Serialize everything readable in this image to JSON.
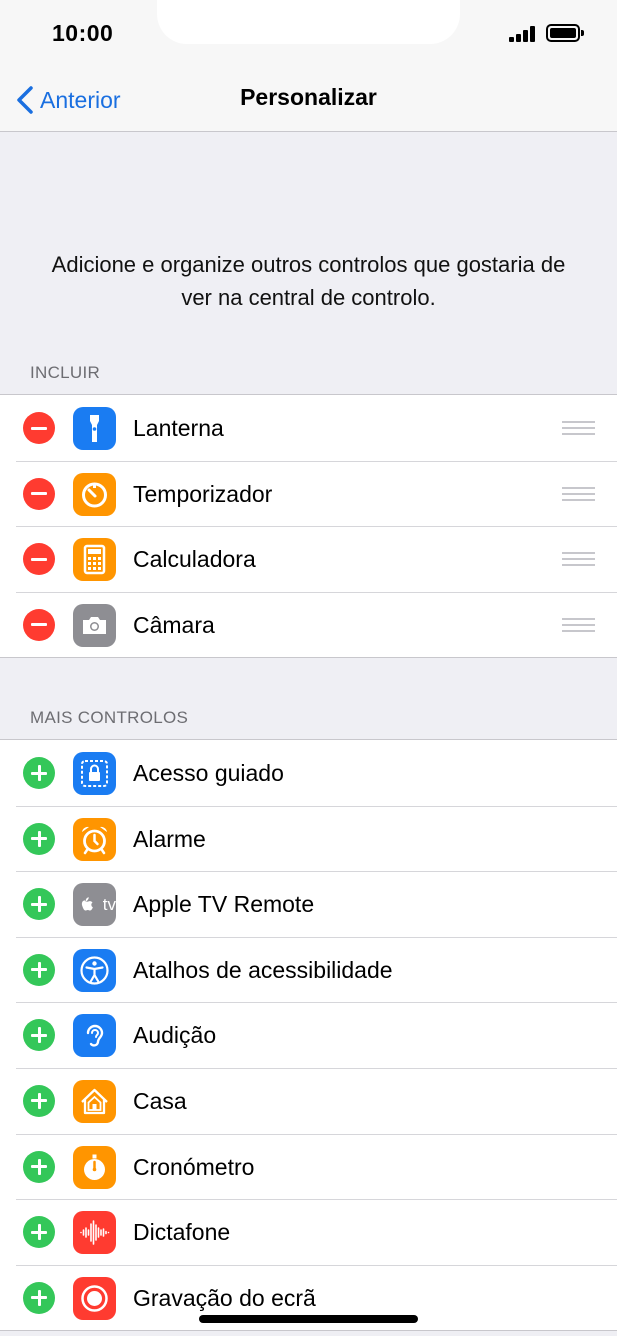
{
  "status_bar": {
    "time": "10:00"
  },
  "nav": {
    "back_label": "Anterior",
    "title": "Personalizar"
  },
  "intro": "Adicione e organize outros controlos que gostaria de ver na central de controlo.",
  "sections": {
    "included": {
      "header": "INCLUIR",
      "items": [
        {
          "label": "Lanterna",
          "icon": "flashlight-icon",
          "color": "#1a7cf2"
        },
        {
          "label": "Temporizador",
          "icon": "timer-icon",
          "color": "#ff9500"
        },
        {
          "label": "Calculadora",
          "icon": "calculator-icon",
          "color": "#ff9500"
        },
        {
          "label": "Câmara",
          "icon": "camera-icon",
          "color": "#8e8e93"
        }
      ]
    },
    "more": {
      "header": "MAIS CONTROLOS",
      "items": [
        {
          "label": "Acesso guiado",
          "icon": "guided-access-icon",
          "color": "#1a7cf2"
        },
        {
          "label": "Alarme",
          "icon": "alarm-icon",
          "color": "#ff9500"
        },
        {
          "label": "Apple TV Remote",
          "icon": "apple-tv-icon",
          "color": "#8e8e93",
          "icon_text": "tv"
        },
        {
          "label": "Atalhos de acessibilidade",
          "icon": "accessibility-icon",
          "color": "#1a7cf2"
        },
        {
          "label": "Audição",
          "icon": "hearing-icon",
          "color": "#1a7cf2"
        },
        {
          "label": "Casa",
          "icon": "home-icon",
          "color": "#ff9500"
        },
        {
          "label": "Cronómetro",
          "icon": "stopwatch-icon",
          "color": "#ff9500"
        },
        {
          "label": "Dictafone",
          "icon": "voice-memos-icon",
          "color": "#ff3b30"
        },
        {
          "label": "Gravação do ecrã",
          "icon": "screen-recording-icon",
          "color": "#ff3b30"
        }
      ]
    }
  },
  "colors": {
    "accent": "#1a6fe0",
    "remove": "#ff3b30",
    "add": "#34c759"
  }
}
